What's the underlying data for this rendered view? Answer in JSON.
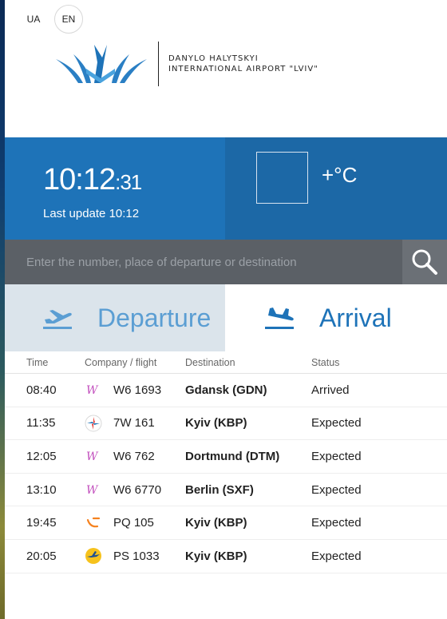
{
  "lang": {
    "ua": "UA",
    "en": "EN",
    "active": "EN"
  },
  "logo": {
    "line1": "DANYLO HALYTSKYI",
    "line2": "INTERNATIONAL AIRPORT \"LVIV\""
  },
  "clock": {
    "hm": "10:12",
    "sec": ":31"
  },
  "last_update": "Last update 10:12",
  "weather": {
    "temp": "+°C"
  },
  "search": {
    "placeholder": "Enter the number, place of departure or destination"
  },
  "tabs": [
    {
      "label": "Departure",
      "icon": "plane-takeoff-icon"
    },
    {
      "label": "Arrival",
      "icon": "plane-landing-icon",
      "active": true
    }
  ],
  "table": {
    "headers": {
      "time": "Time",
      "company": "Company / flight",
      "destination": "Destination",
      "status": "Status"
    },
    "rows": [
      {
        "time": "08:40",
        "airline": "wizzair-logo",
        "flight": "W6 1693",
        "destination": "Gdansk (GDN)",
        "status": "Arrived"
      },
      {
        "time": "11:35",
        "airline": "windrose-logo",
        "flight": "7W 161",
        "destination": "Kyiv (KBP)",
        "status": "Expected"
      },
      {
        "time": "12:05",
        "airline": "wizzair-logo",
        "flight": "W6 762",
        "destination": "Dortmund (DTM)",
        "status": "Expected"
      },
      {
        "time": "13:10",
        "airline": "wizzair-logo",
        "flight": "W6 6770",
        "destination": "Berlin (SXF)",
        "status": "Expected"
      },
      {
        "time": "19:45",
        "airline": "pegasus-logo",
        "flight": "PQ 105",
        "destination": "Kyiv (KBP)",
        "status": "Expected"
      },
      {
        "time": "20:05",
        "airline": "uia-logo",
        "flight": "PS 1033",
        "destination": "Kyiv (KBP)",
        "status": "Expected"
      }
    ]
  },
  "colors": {
    "brand_blue": "#1e73b8",
    "weather_blue": "#1c68a6",
    "search_bg": "#5b6066",
    "departure_bg": "#dbe4eb"
  }
}
